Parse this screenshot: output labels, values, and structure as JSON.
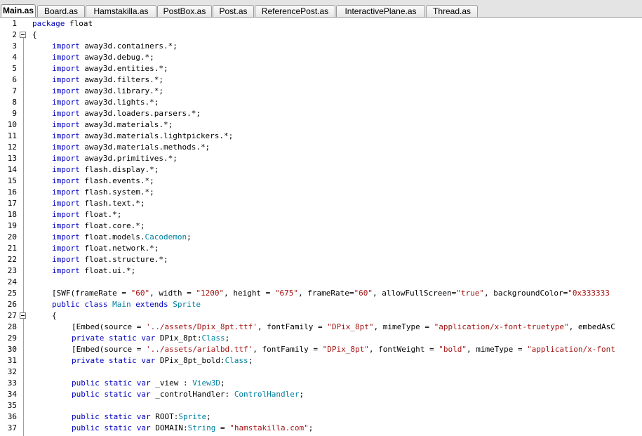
{
  "tabs": [
    {
      "label": "Main.as",
      "active": true
    },
    {
      "label": "Board.as"
    },
    {
      "label": "Hamstakilla.as"
    },
    {
      "label": "PostBox.as"
    },
    {
      "label": "Post.as"
    },
    {
      "label": "ReferencePost.as"
    },
    {
      "label": "InteractivePlane.as"
    },
    {
      "label": "Thread.as"
    }
  ],
  "colors": {
    "keyword": "#0000c0",
    "type": "#0080a0",
    "string": "#a31515",
    "text": "#000000"
  },
  "lines": [
    {
      "n": "1",
      "indent": 0,
      "t": [
        [
          "kw",
          "package"
        ],
        [
          "",
          "float"
        ]
      ]
    },
    {
      "n": "2",
      "indent": 0,
      "t": [
        [
          "",
          "{"
        ]
      ]
    },
    {
      "n": "3",
      "indent": 1,
      "t": [
        [
          "kw",
          "import"
        ],
        [
          "",
          "away3d.containers.*;"
        ]
      ]
    },
    {
      "n": "4",
      "indent": 1,
      "t": [
        [
          "kw",
          "import"
        ],
        [
          "",
          "away3d.debug.*;"
        ]
      ]
    },
    {
      "n": "5",
      "indent": 1,
      "t": [
        [
          "kw",
          "import"
        ],
        [
          "",
          "away3d.entities.*;"
        ]
      ]
    },
    {
      "n": "6",
      "indent": 1,
      "t": [
        [
          "kw",
          "import"
        ],
        [
          "",
          "away3d.filters.*;"
        ]
      ]
    },
    {
      "n": "7",
      "indent": 1,
      "t": [
        [
          "kw",
          "import"
        ],
        [
          "",
          "away3d.library.*;"
        ]
      ]
    },
    {
      "n": "8",
      "indent": 1,
      "t": [
        [
          "kw",
          "import"
        ],
        [
          "",
          "away3d.lights.*;"
        ]
      ]
    },
    {
      "n": "9",
      "indent": 1,
      "t": [
        [
          "kw",
          "import"
        ],
        [
          "",
          "away3d.loaders.parsers.*;"
        ]
      ]
    },
    {
      "n": "10",
      "indent": 1,
      "t": [
        [
          "kw",
          "import"
        ],
        [
          "",
          "away3d.materials.*;"
        ]
      ]
    },
    {
      "n": "11",
      "indent": 1,
      "t": [
        [
          "kw",
          "import"
        ],
        [
          "",
          "away3d.materials.lightpickers.*;"
        ]
      ]
    },
    {
      "n": "12",
      "indent": 1,
      "t": [
        [
          "kw",
          "import"
        ],
        [
          "",
          "away3d.materials.methods.*;"
        ]
      ]
    },
    {
      "n": "13",
      "indent": 1,
      "t": [
        [
          "kw",
          "import"
        ],
        [
          "",
          "away3d.primitives.*;"
        ]
      ]
    },
    {
      "n": "14",
      "indent": 1,
      "t": [
        [
          "kw",
          "import"
        ],
        [
          "",
          "flash.display.*;"
        ]
      ]
    },
    {
      "n": "15",
      "indent": 1,
      "t": [
        [
          "kw",
          "import"
        ],
        [
          "",
          "flash.events.*;"
        ]
      ]
    },
    {
      "n": "16",
      "indent": 1,
      "t": [
        [
          "kw",
          "import"
        ],
        [
          "",
          "flash.system.*;"
        ]
      ]
    },
    {
      "n": "17",
      "indent": 1,
      "t": [
        [
          "kw",
          "import"
        ],
        [
          "",
          "flash.text.*;"
        ]
      ]
    },
    {
      "n": "18",
      "indent": 1,
      "t": [
        [
          "kw",
          "import"
        ],
        [
          "",
          "float.*;"
        ]
      ]
    },
    {
      "n": "19",
      "indent": 1,
      "t": [
        [
          "kw",
          "import"
        ],
        [
          "",
          "float.core.*;"
        ]
      ]
    },
    {
      "n": "20",
      "indent": 1,
      "t": [
        [
          "kw",
          "import"
        ],
        [
          "",
          "float.models."
        ],
        [
          "ty",
          "Cacodemon"
        ],
        [
          "",
          ";"
        ]
      ]
    },
    {
      "n": "21",
      "indent": 1,
      "t": [
        [
          "kw",
          "import"
        ],
        [
          "",
          "float.network.*;"
        ]
      ]
    },
    {
      "n": "22",
      "indent": 1,
      "t": [
        [
          "kw",
          "import"
        ],
        [
          "",
          "float.structure.*;"
        ]
      ]
    },
    {
      "n": "23",
      "indent": 1,
      "t": [
        [
          "kw",
          "import"
        ],
        [
          "",
          "float.ui.*;"
        ]
      ]
    },
    {
      "n": "24",
      "indent": 0,
      "t": []
    },
    {
      "n": "25",
      "indent": 1,
      "t": [
        [
          "",
          "[SWF(frameRate = "
        ],
        [
          "str",
          "\"60\""
        ],
        [
          "",
          ", width = "
        ],
        [
          "str",
          "\"1200\""
        ],
        [
          "",
          ", height = "
        ],
        [
          "str",
          "\"675\""
        ],
        [
          "",
          ", frameRate="
        ],
        [
          "str",
          "\"60\""
        ],
        [
          "",
          ", allowFullScreen="
        ],
        [
          "str",
          "\"true\""
        ],
        [
          "",
          ", backgroundColor="
        ],
        [
          "str",
          "\"0x333333"
        ]
      ]
    },
    {
      "n": "26",
      "indent": 1,
      "t": [
        [
          "kw",
          "public class"
        ],
        [
          "ty",
          "Main"
        ],
        [
          "kw",
          "extends"
        ],
        [
          "ty",
          "Sprite"
        ]
      ]
    },
    {
      "n": "27",
      "indent": 1,
      "t": [
        [
          "",
          "{"
        ]
      ]
    },
    {
      "n": "28",
      "indent": 2,
      "t": [
        [
          "",
          "[Embed(source = "
        ],
        [
          "str",
          "'../assets/Dpix_8pt.ttf'"
        ],
        [
          "",
          ", fontFamily = "
        ],
        [
          "str",
          "\"DPix_8pt\""
        ],
        [
          "",
          ", mimeType = "
        ],
        [
          "str",
          "\"application/x-font-truetype\""
        ],
        [
          "",
          ", embedAsC"
        ]
      ]
    },
    {
      "n": "29",
      "indent": 2,
      "t": [
        [
          "kw",
          "private static var"
        ],
        [
          "",
          "DPix_8pt:"
        ],
        [
          "ty",
          "Class"
        ],
        [
          "",
          ";"
        ]
      ]
    },
    {
      "n": "30",
      "indent": 2,
      "t": [
        [
          "",
          "[Embed(source = "
        ],
        [
          "str",
          "'../assets/arialbd.ttf'"
        ],
        [
          "",
          ", fontFamily = "
        ],
        [
          "str",
          "\"DPix_8pt\""
        ],
        [
          "",
          ", fontWeight = "
        ],
        [
          "str",
          "\"bold\""
        ],
        [
          "",
          ", mimeType = "
        ],
        [
          "str",
          "\"application/x-font"
        ]
      ]
    },
    {
      "n": "31",
      "indent": 2,
      "t": [
        [
          "kw",
          "private static var"
        ],
        [
          "",
          "DPix_8pt_bold:"
        ],
        [
          "ty",
          "Class"
        ],
        [
          "",
          ";"
        ]
      ]
    },
    {
      "n": "32",
      "indent": 0,
      "t": []
    },
    {
      "n": "33",
      "indent": 2,
      "t": [
        [
          "kw",
          "public static var"
        ],
        [
          "",
          "_view : "
        ],
        [
          "ty",
          "View3D"
        ],
        [
          "",
          ";"
        ]
      ]
    },
    {
      "n": "34",
      "indent": 2,
      "t": [
        [
          "kw",
          "public static var"
        ],
        [
          "",
          "_controlHandler: "
        ],
        [
          "ty",
          "ControlHandler"
        ],
        [
          "",
          ";"
        ]
      ]
    },
    {
      "n": "35",
      "indent": 0,
      "t": []
    },
    {
      "n": "36",
      "indent": 2,
      "t": [
        [
          "kw",
          "public static var"
        ],
        [
          "",
          "ROOT:"
        ],
        [
          "ty",
          "Sprite"
        ],
        [
          "",
          ";"
        ]
      ]
    },
    {
      "n": "37",
      "indent": 2,
      "t": [
        [
          "kw",
          "public static var"
        ],
        [
          "",
          "DOMAIN:"
        ],
        [
          "ty",
          "String"
        ],
        [
          "",
          " = "
        ],
        [
          "str",
          "\"hamstakilla.com\""
        ],
        [
          "",
          ";"
        ]
      ]
    }
  ]
}
